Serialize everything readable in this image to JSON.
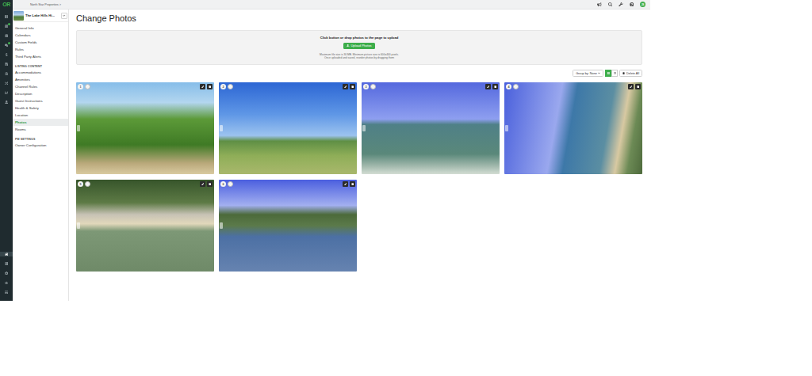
{
  "app": {
    "logo": "OR"
  },
  "topbar": {
    "breadcrumb": "North Star Properties >",
    "avatar": "JS"
  },
  "rail": {
    "top": [
      {
        "kind": "dashboard",
        "badge": false,
        "selected": false
      },
      {
        "kind": "calendar",
        "badge": true,
        "selected": false
      },
      {
        "kind": "tasks",
        "badge": false,
        "selected": false
      },
      {
        "kind": "messages",
        "badge": true,
        "selected": false
      },
      {
        "kind": "finance",
        "badge": false,
        "selected": false
      },
      {
        "kind": "documents",
        "badge": false,
        "selected": false
      },
      {
        "kind": "bank",
        "badge": false,
        "selected": false
      },
      {
        "kind": "channels",
        "badge": false,
        "selected": false
      },
      {
        "kind": "reports",
        "badge": false,
        "selected": false
      },
      {
        "kind": "contacts",
        "badge": false,
        "selected": false
      }
    ],
    "bottom": [
      {
        "kind": "home",
        "badge": false,
        "selected": true
      },
      {
        "kind": "properties",
        "badge": false,
        "selected": false
      },
      {
        "kind": "settings",
        "badge": false,
        "selected": false
      },
      {
        "kind": "team",
        "badge": false,
        "selected": false
      },
      {
        "kind": "billing",
        "badge": false,
        "selected": false
      }
    ]
  },
  "property": {
    "name": "The Lake Hills Hi..."
  },
  "sidebar": {
    "sections": [
      {
        "heading": "",
        "items": [
          {
            "label": "General Info",
            "selected": false
          },
          {
            "label": "Calendars",
            "selected": false
          },
          {
            "label": "Custom Fields",
            "selected": false
          },
          {
            "label": "Rules",
            "selected": false
          },
          {
            "label": "Third Party Alerts",
            "selected": false
          }
        ]
      },
      {
        "heading": "LISTING CONTENT",
        "items": [
          {
            "label": "Accommodations",
            "selected": false
          },
          {
            "label": "Amenities",
            "selected": false
          },
          {
            "label": "Channel Rules",
            "selected": false
          },
          {
            "label": "Description",
            "selected": false
          },
          {
            "label": "Guest Instructions",
            "selected": false
          },
          {
            "label": "Health & Safety",
            "selected": false
          },
          {
            "label": "Location",
            "selected": false
          },
          {
            "label": "Photos",
            "selected": true
          },
          {
            "label": "Rooms",
            "selected": false
          }
        ]
      },
      {
        "heading": "PM SETTINGS",
        "items": [
          {
            "label": "Owner Configuration",
            "selected": false
          }
        ]
      }
    ]
  },
  "page": {
    "title": "Change Photos"
  },
  "upload": {
    "prompt": "Click button or drop photos to the page to upload",
    "button": "Upload Photos",
    "notes": [
      "Maximum file size is 30 MB. Minimum picture size is 600x400 pixels.",
      "Once uploaded and saved, reorder photos by dragging them"
    ]
  },
  "toolbar": {
    "group_by": "Group by: None",
    "views": [
      {
        "kind": "grid",
        "selected": true
      },
      {
        "kind": "list",
        "selected": false
      }
    ],
    "delete_all": "Delete All"
  },
  "photos": [
    {
      "number": "1"
    },
    {
      "number": "2"
    },
    {
      "number": "3"
    },
    {
      "number": "4"
    },
    {
      "number": "5"
    },
    {
      "number": "6"
    }
  ]
}
